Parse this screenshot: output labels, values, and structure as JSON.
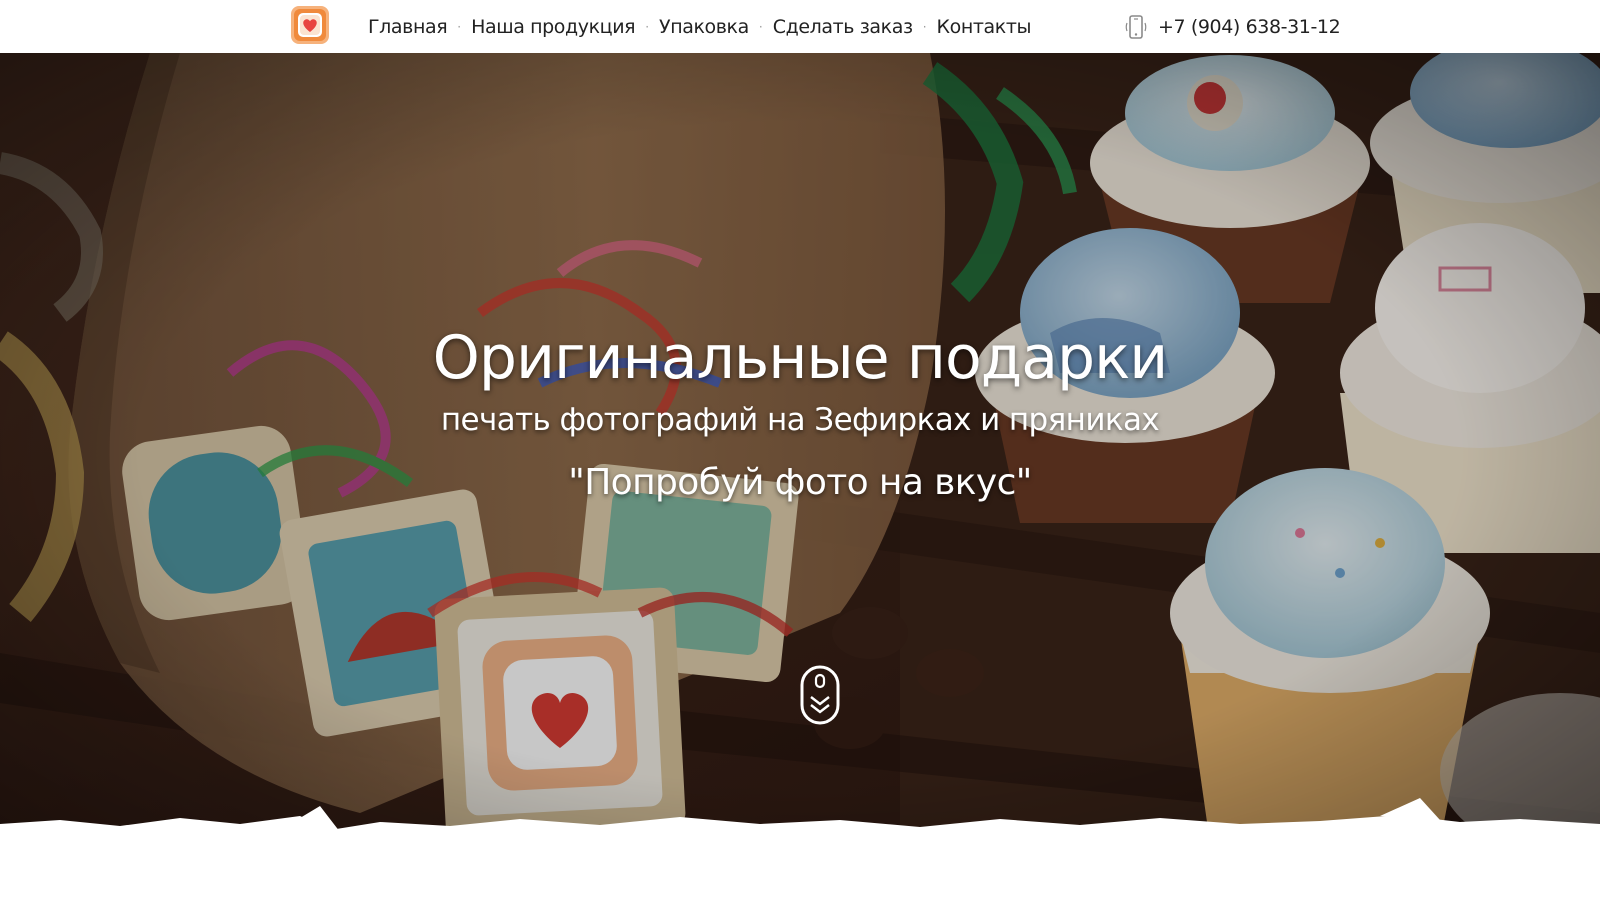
{
  "header": {
    "logo_icon": "heart-photo-logo-icon",
    "nav": [
      {
        "label": "Главная"
      },
      {
        "label": "Наша продукция"
      },
      {
        "label": "Упаковка"
      },
      {
        "label": "Сделать заказ"
      },
      {
        "label": "Контакты"
      }
    ],
    "nav_separator": "·",
    "phone_icon": "mobile-phone-icon",
    "phone": "+7 (904) 638-31-12"
  },
  "hero": {
    "title": "Оригинальные подарки",
    "subtitle": "печать фотографий на Зефирках и пряниках",
    "slogan": "\"Попробуй фото на вкус\"",
    "scroll_icon": "scroll-down-mouse-icon"
  },
  "colors": {
    "header_bg": "#ffffff",
    "nav_text": "#222222",
    "logo_accent": "#f08a3c",
    "hero_text": "#ffffff"
  }
}
